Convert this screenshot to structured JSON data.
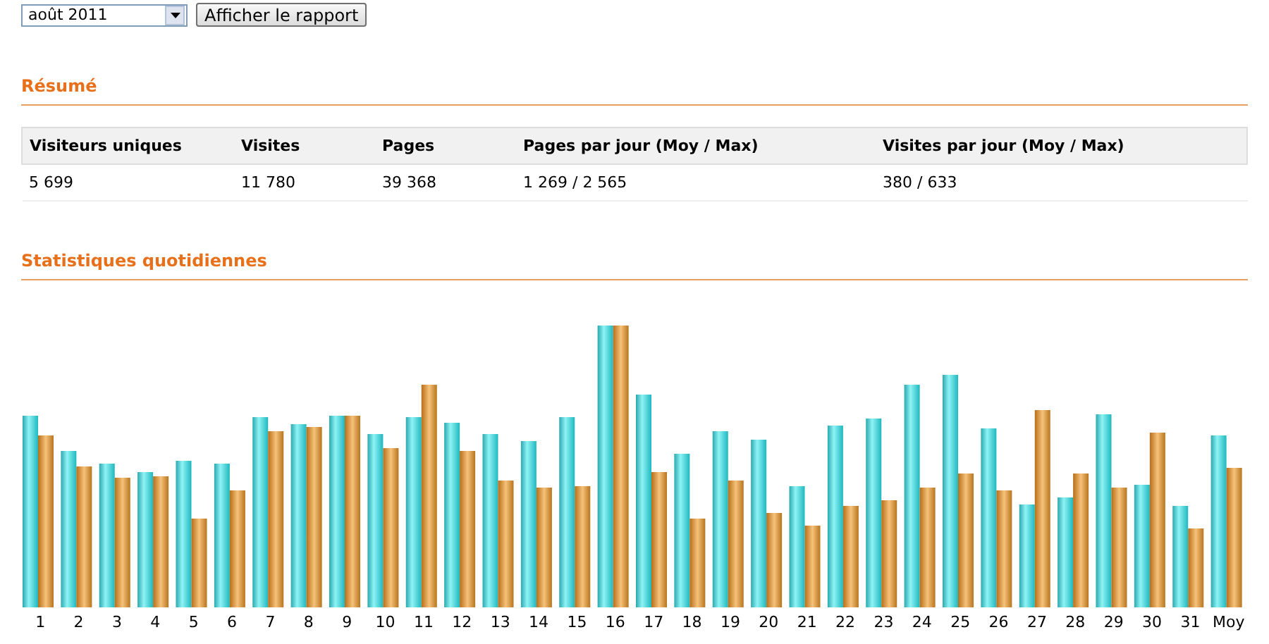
{
  "controls": {
    "month_select": {
      "value": "août 2011"
    },
    "show_button": "Afficher le rapport"
  },
  "summary": {
    "heading": "Résumé",
    "columns": [
      "Visiteurs uniques",
      "Visites",
      "Pages",
      "Pages par jour (Moy / Max)",
      "Visites par jour (Moy / Max)"
    ],
    "rows": [
      [
        "5 699",
        "11 780",
        "39 368",
        "1 269 / 2 565",
        "380 / 633"
      ]
    ]
  },
  "daily": {
    "heading": "Statistiques quotidiennes",
    "day_labels": [
      "1",
      "2",
      "3",
      "4",
      "5",
      "6",
      "7",
      "8",
      "9",
      "10",
      "11",
      "12",
      "13",
      "14",
      "15",
      "16",
      "17",
      "18",
      "19",
      "20",
      "21",
      "22",
      "23",
      "24",
      "25",
      "26",
      "27",
      "28",
      "29",
      "30",
      "31",
      "Moy"
    ]
  }
}
